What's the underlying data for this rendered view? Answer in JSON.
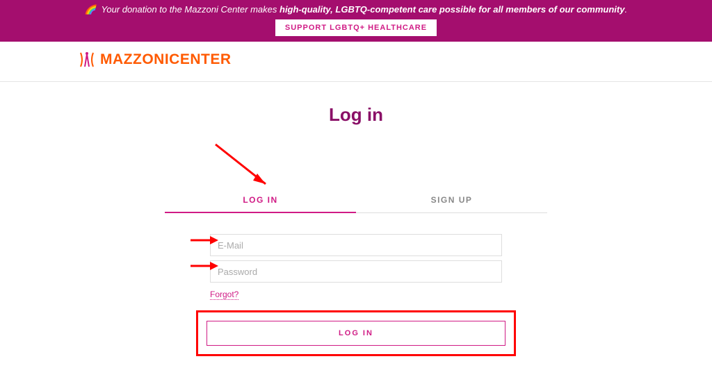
{
  "banner": {
    "emoji": "🌈",
    "text_prefix": "Your donation to the Mazzoni Center makes ",
    "bold1": "high-quality, LGBTQ-competent care possible for all members of our community",
    "period": ".",
    "cta": "SUPPORT LGBTQ+ HEALTHCARE"
  },
  "logo": {
    "word1": "MAZZONI",
    "word2": " CENTER"
  },
  "page": {
    "title": "Log in"
  },
  "tabs": {
    "login": "LOG IN",
    "signup": "SIGN UP"
  },
  "form": {
    "email_placeholder": "E-Mail",
    "password_placeholder": "Password",
    "forgot": "Forgot?",
    "submit": "LOG IN"
  },
  "colors": {
    "brand_purple": "#a40e6e",
    "brand_pink": "#d01b85",
    "brand_orange": "#ff5a00",
    "annotation_red": "#ff0000"
  }
}
